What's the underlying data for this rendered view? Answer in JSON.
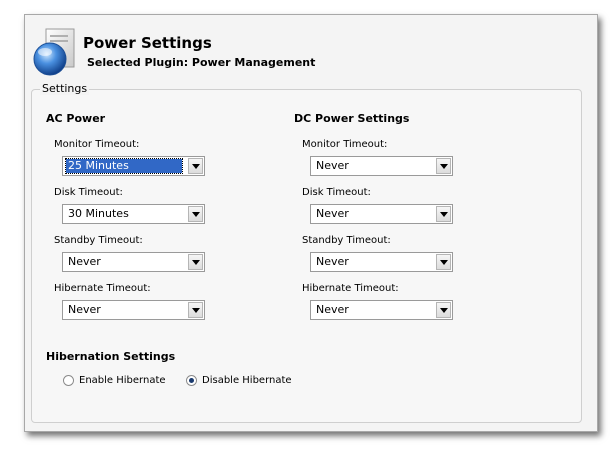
{
  "header": {
    "title": "Power Settings",
    "subtitle": "Selected Plugin: Power Management"
  },
  "group": {
    "legend": "Settings"
  },
  "ac": {
    "title": "AC Power",
    "monitor_label": "Monitor Timeout:",
    "monitor_value": "25 Minutes",
    "disk_label": "Disk Timeout:",
    "disk_value": "30 Minutes",
    "standby_label": "Standby Timeout:",
    "standby_value": "Never",
    "hibernate_label": "Hibernate Timeout:",
    "hibernate_value": "Never"
  },
  "dc": {
    "title": "DC Power Settings",
    "monitor_label": "Monitor Timeout:",
    "monitor_value": "Never",
    "disk_label": "Disk Timeout:",
    "disk_value": "Never",
    "standby_label": "Standby Timeout:",
    "standby_value": "Never",
    "hibernate_label": "Hibernate Timeout:",
    "hibernate_value": "Never"
  },
  "hibernation": {
    "title": "Hibernation Settings",
    "enable_label": "Enable Hibernate",
    "disable_label": "Disable Hibernate",
    "selected": "disable"
  },
  "colors": {
    "selection": "#3168c6",
    "window_bg": "#f4f4f4"
  },
  "icons": {
    "app": "power-globe-icon",
    "dropdown": "chevron-down-icon"
  }
}
